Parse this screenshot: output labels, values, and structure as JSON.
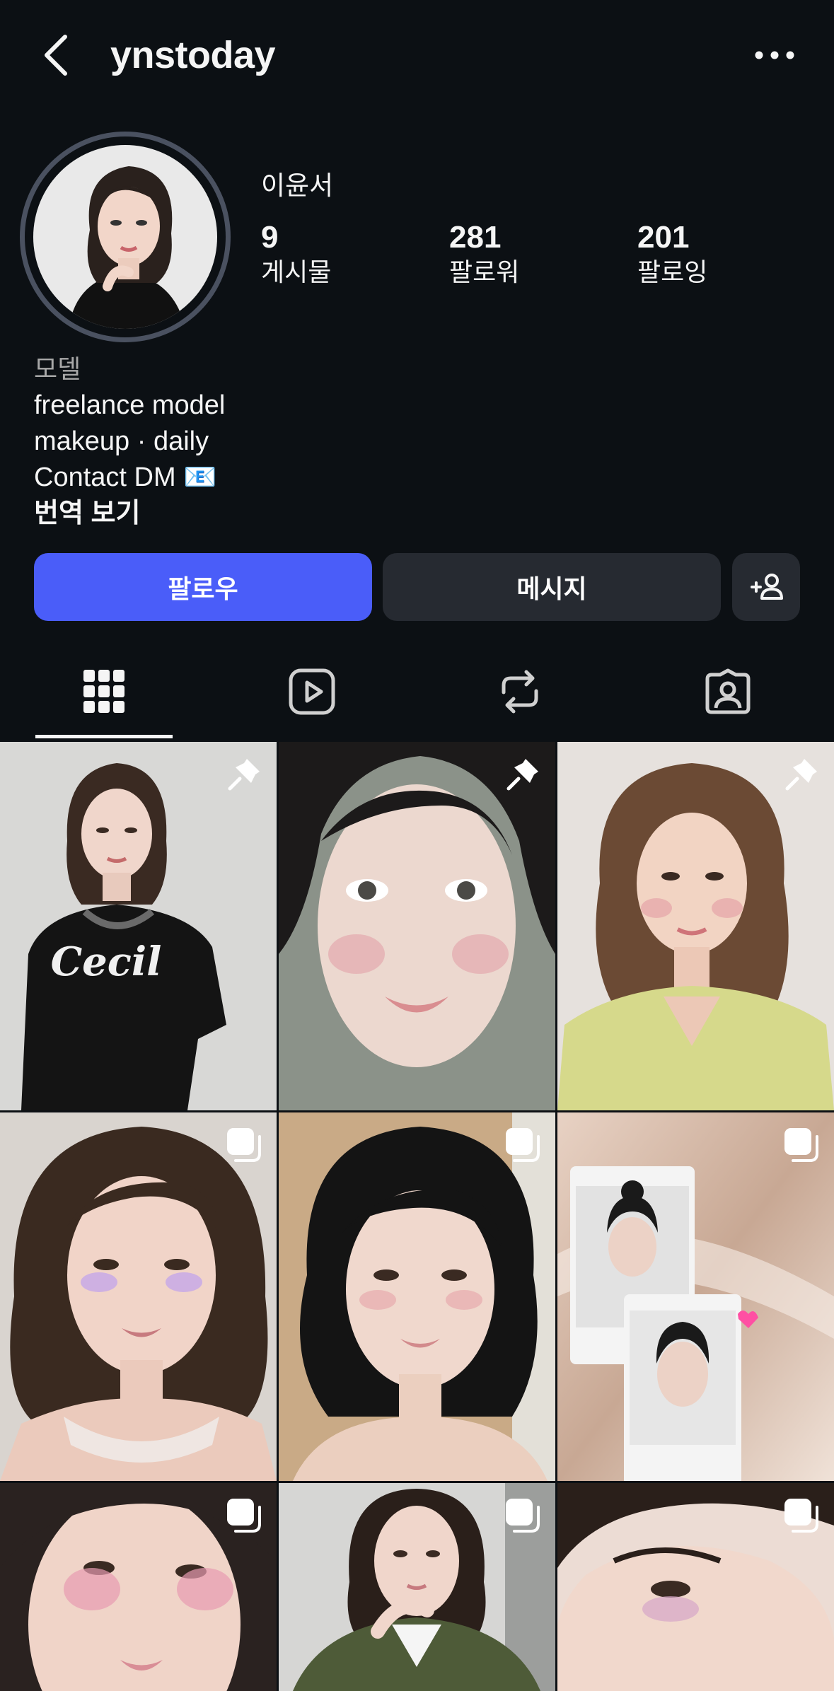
{
  "header": {
    "username": "ynstoday",
    "back_icon": "chevron-left-icon",
    "more_icon": "more-horizontal-icon"
  },
  "profile": {
    "display_name": "이윤서",
    "stats": [
      {
        "value": "9",
        "label": "게시물"
      },
      {
        "value": "281",
        "label": "팔로워"
      },
      {
        "value": "201",
        "label": "팔로잉"
      }
    ]
  },
  "bio": {
    "category": "모델",
    "lines": [
      "freelance model",
      "makeup · daily",
      "Contact DM 📧"
    ],
    "translate_label": "번역 보기"
  },
  "actions": {
    "follow_label": "팔로우",
    "message_label": "메시지",
    "suggest_icon": "add-person-icon"
  },
  "tabs": [
    {
      "name": "posts",
      "icon": "grid-icon",
      "active": true
    },
    {
      "name": "reels",
      "icon": "play-icon",
      "active": false
    },
    {
      "name": "reposts",
      "icon": "repost-icon",
      "active": false
    },
    {
      "name": "tagged",
      "icon": "tagged-person-icon",
      "active": false
    }
  ],
  "colors": {
    "background": "#0c1014",
    "follow_button": "#4a5df9",
    "secondary_button": "#262a31",
    "muted_text": "#a8a8a8"
  },
  "grid": {
    "posts": [
      {
        "badge": "pin-icon",
        "shirt_text": "Cecil"
      },
      {
        "badge": "pin-icon"
      },
      {
        "badge": "pin-icon"
      },
      {
        "badge": "carousel-icon"
      },
      {
        "badge": "carousel-icon"
      },
      {
        "badge": "carousel-icon"
      },
      {
        "badge": "carousel-icon"
      },
      {
        "badge": "carousel-icon"
      },
      {
        "badge": "carousel-icon"
      }
    ]
  }
}
